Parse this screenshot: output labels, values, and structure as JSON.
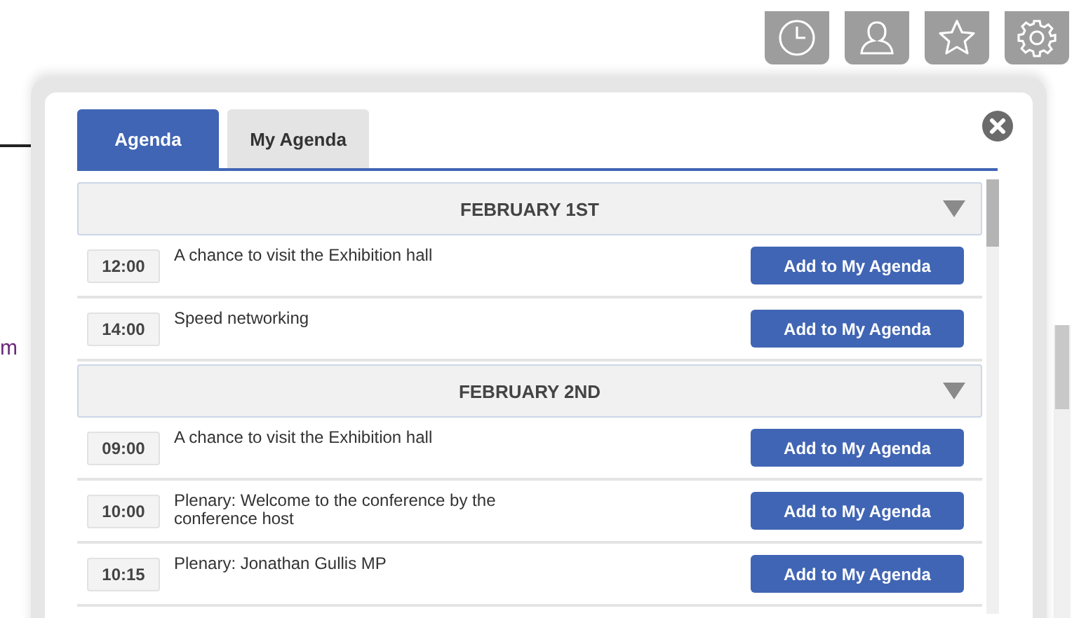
{
  "page_fragment": "m",
  "toolbar": [
    {
      "kind": "clock"
    },
    {
      "kind": "user"
    },
    {
      "kind": "star"
    },
    {
      "kind": "gear"
    }
  ],
  "tabs": [
    {
      "label": "Agenda",
      "selected": true
    },
    {
      "label": "My Agenda",
      "selected": false
    }
  ],
  "days": [
    {
      "title": "FEBRUARY 1ST",
      "expanded": true,
      "sessions": [
        {
          "time": "12:00",
          "title": "A chance to visit the Exhibition hall",
          "button": "Add to My Agenda"
        },
        {
          "time": "14:00",
          "title": "Speed networking",
          "button": "Add to My Agenda"
        }
      ]
    },
    {
      "title": "FEBRUARY 2ND",
      "expanded": true,
      "sessions": [
        {
          "time": "09:00",
          "title": "A chance to visit the Exhibition hall",
          "button": "Add to My Agenda"
        },
        {
          "time": "10:00",
          "title": "Plenary: Welcome to the conference by the conference host",
          "button": "Add to My Agenda"
        },
        {
          "time": "10:15",
          "title": "Plenary: Jonathan Gullis MP",
          "button": "Add to My Agenda"
        }
      ]
    }
  ]
}
